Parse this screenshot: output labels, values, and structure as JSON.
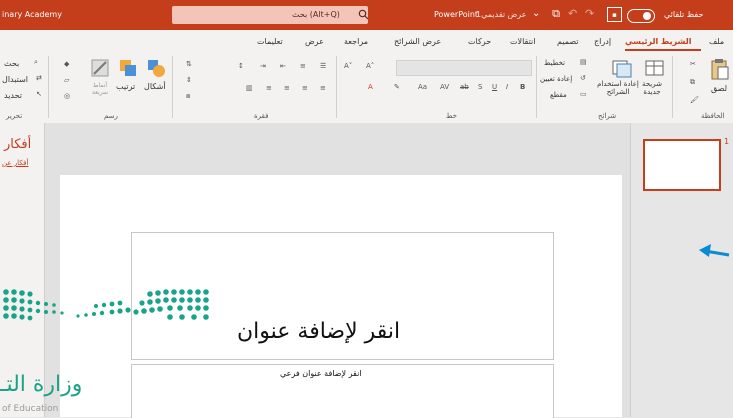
{
  "titlebar": {
    "left_text": "inary Academy",
    "search_text": "(Alt+Q) بحث",
    "app_name": "PowerPoint",
    "doc_name": "عرض تقديمي1",
    "autosave": "حفظ تلقائي",
    "colors": {
      "bar": "#c43e1c",
      "search": "#f5c4b8",
      "accent": "#c43e1c"
    }
  },
  "tabs": [
    "ملف",
    "الشريط الرئيسي",
    "إدراج",
    "تصميم",
    "انتقالات",
    "حركات",
    "عرض الشرائح",
    "مراجعة",
    "عرض",
    "تعليمات"
  ],
  "ribbon": {
    "clipboard": {
      "paste": "لصق",
      "label": "الحافظة"
    },
    "slides": {
      "new_slide": "شريحة جديدة",
      "reuse": "إعادة استخدام الشرائح",
      "layout": "تخطيط",
      "reset": "إعادة تعيين",
      "section": "مقطع",
      "label": "شرائح"
    },
    "font": {
      "label": "خط"
    },
    "paragraph": {
      "label": "فقرة"
    },
    "drawing": {
      "shapes": "أشكال",
      "arrange": "ترتيب",
      "quick_styles": "أنماط سريعة",
      "label": "رسم"
    },
    "editing": {
      "find": "بحث",
      "replace": "استبدال",
      "select": "تحديد",
      "label": "تحرير"
    }
  },
  "right_panel": {
    "title": "أفكار",
    "link": "أفكار عن"
  },
  "slide": {
    "title_placeholder": "انقر لإضافة عنوان",
    "subtitle_placeholder": "انقر لإضافة عنوان فرعي"
  },
  "thumbnail": {
    "number": "1"
  },
  "watermark": {
    "text": "وزارة التـ",
    "subtext": "of Education"
  }
}
